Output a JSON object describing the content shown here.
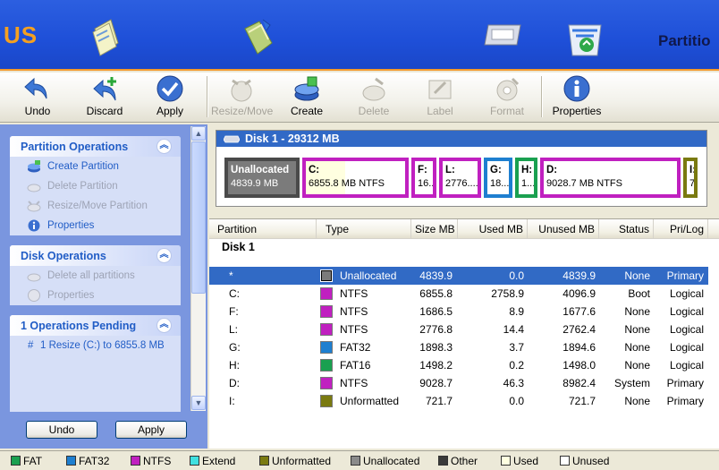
{
  "banner": {
    "brand": "US",
    "title": "Partitio"
  },
  "toolbar": {
    "buttons": [
      {
        "label": "Undo"
      },
      {
        "label": "Discard"
      },
      {
        "label": "Apply"
      },
      {
        "label": "Resize/Move"
      },
      {
        "label": "Create"
      },
      {
        "label": "Delete"
      },
      {
        "label": "Label"
      },
      {
        "label": "Format"
      },
      {
        "label": "Properties"
      }
    ]
  },
  "left": {
    "partition_ops": {
      "title": "Partition Operations",
      "items": [
        "Create Partition",
        "Delete Partition",
        "Resize/Move Partition",
        "Properties"
      ]
    },
    "disk_ops": {
      "title": "Disk Operations",
      "items": [
        "Delete all partitions",
        "Properties"
      ]
    },
    "pending": {
      "title": "1 Operations Pending",
      "hash": "#",
      "item": "1  Resize (C:) to 6855.8 MB"
    },
    "undo_label": "Undo",
    "apply_label": "Apply"
  },
  "diskmap": {
    "header": "Disk 1 - 29312 MB",
    "segments": [
      {
        "name": "Unallocated",
        "info": "4839.9 MB",
        "color": "#4A4A4A"
      },
      {
        "name": "C:",
        "info": "6855.8 MB  NTFS",
        "color": "#C020C0",
        "used_fraction": 0.4
      },
      {
        "name": "F:",
        "info": "16..",
        "color": "#C020C0"
      },
      {
        "name": "L:",
        "info": "2776....",
        "color": "#C020C0"
      },
      {
        "name": "G:",
        "info": "18...",
        "color": "#1E7FD0"
      },
      {
        "name": "H:",
        "info": "1...",
        "color": "#1AA050"
      },
      {
        "name": "D:",
        "info": "9028.7 MB  NTFS",
        "color": "#C020C0"
      },
      {
        "name": "I:",
        "info": "7",
        "color": "#7A7A10"
      }
    ]
  },
  "table": {
    "columns": [
      "Partition",
      "Type",
      "Size MB",
      "Used MB",
      "Unused MB",
      "Status",
      "Pri/Log"
    ],
    "group": "Disk 1",
    "rows": [
      {
        "partition": "*",
        "type": "Unallocated",
        "color": "#7B7B7B",
        "size": "4839.9",
        "used": "0.0",
        "unused": "4839.9",
        "status": "None",
        "prilog": "Primary"
      },
      {
        "partition": "C:",
        "type": "NTFS",
        "color": "#C020C0",
        "size": "6855.8",
        "used": "2758.9",
        "unused": "4096.9",
        "status": "Boot",
        "prilog": "Logical"
      },
      {
        "partition": "F:",
        "type": "NTFS",
        "color": "#C020C0",
        "size": "1686.5",
        "used": "8.9",
        "unused": "1677.6",
        "status": "None",
        "prilog": "Logical"
      },
      {
        "partition": "L:",
        "type": "NTFS",
        "color": "#C020C0",
        "size": "2776.8",
        "used": "14.4",
        "unused": "2762.4",
        "status": "None",
        "prilog": "Logical"
      },
      {
        "partition": "G:",
        "type": "FAT32",
        "color": "#1E7FD0",
        "size": "1898.3",
        "used": "3.7",
        "unused": "1894.6",
        "status": "None",
        "prilog": "Logical"
      },
      {
        "partition": "H:",
        "type": "FAT16",
        "color": "#1AA050",
        "size": "1498.2",
        "used": "0.2",
        "unused": "1498.0",
        "status": "None",
        "prilog": "Logical"
      },
      {
        "partition": "D:",
        "type": "NTFS",
        "color": "#C020C0",
        "size": "9028.7",
        "used": "46.3",
        "unused": "8982.4",
        "status": "System",
        "prilog": "Primary"
      },
      {
        "partition": "I:",
        "type": "Unformatted",
        "color": "#7A7A10",
        "size": "721.7",
        "used": "0.0",
        "unused": "721.7",
        "status": "None",
        "prilog": "Primary"
      }
    ]
  },
  "legend": [
    {
      "label": "FAT",
      "color": "#1AA050"
    },
    {
      "label": "FAT32",
      "color": "#1E7FD0"
    },
    {
      "label": "NTFS",
      "color": "#C020C0"
    },
    {
      "label": "Extend",
      "color": "#40E0E0"
    },
    {
      "label": "Unformatted",
      "color": "#7A7A10"
    },
    {
      "label": "Unallocated",
      "color": "#8A8A8A"
    },
    {
      "label": "Other",
      "color": "#3A3A3A"
    },
    {
      "label": "Used",
      "color": "#FFFFE0"
    },
    {
      "label": "Unused",
      "color": "#FFFFFF"
    }
  ]
}
